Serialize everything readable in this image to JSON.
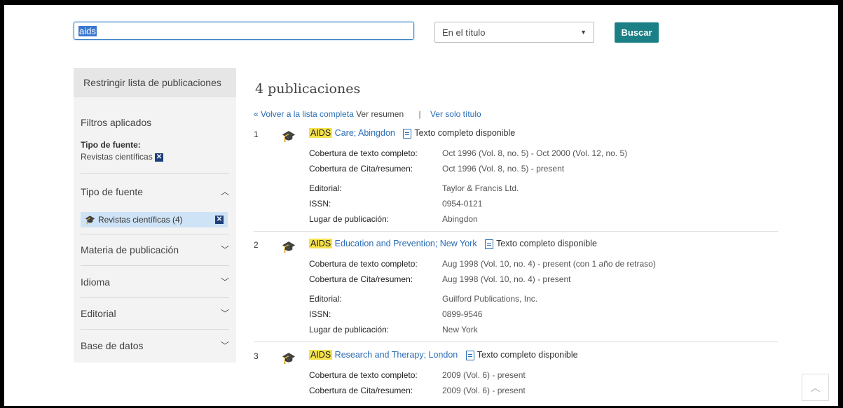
{
  "search": {
    "query": "aids",
    "field": "En el título",
    "button": "Buscar"
  },
  "sidebar": {
    "header": "Restringir lista de publicaciones",
    "applied_title": "Filtros aplicados",
    "applied_type_label": "Tipo de fuente:",
    "applied_type_value": "Revistas científicas",
    "facets": {
      "source_type": "Tipo de fuente",
      "source_type_selected": "Revistas científicas (4)",
      "subject": "Materia de publicación",
      "language": "Idioma",
      "publisher": "Editorial",
      "database": "Base de datos"
    }
  },
  "results": {
    "count": "4 publicaciones",
    "back_link": "« Volver a la lista completa",
    "view_summary": "Ver resumen",
    "separator": "|",
    "view_title": "Ver solo título",
    "items": [
      {
        "num": "1",
        "highlight": "AIDS",
        "title": "Care; Abingdon",
        "fulltext": "Texto completo disponible",
        "rows": [
          {
            "k": "Cobertura de texto completo:",
            "v": "Oct 1996 (Vol. 8, no. 5) - Oct 2000 (Vol. 12, no. 5)"
          },
          {
            "k": "Cobertura de Cita/resumen:",
            "v": "Oct 1996 (Vol. 8, no. 5) - present"
          },
          {
            "k": "Editorial:",
            "v": "Taylor & Francis Ltd."
          },
          {
            "k": "ISSN:",
            "v": "0954-0121"
          },
          {
            "k": "Lugar de publicación:",
            "v": "Abingdon"
          }
        ]
      },
      {
        "num": "2",
        "highlight": "AIDS",
        "title": "Education and Prevention; New York",
        "fulltext": "Texto completo disponible",
        "rows": [
          {
            "k": "Cobertura de texto completo:",
            "v": "Aug 1998 (Vol. 10, no. 4) - present (con 1 año de retraso)"
          },
          {
            "k": "Cobertura de Cita/resumen:",
            "v": "Aug 1998 (Vol. 10, no. 4) - present"
          },
          {
            "k": "Editorial:",
            "v": "Guilford Publications, Inc."
          },
          {
            "k": "ISSN:",
            "v": "0899-9546"
          },
          {
            "k": "Lugar de publicación:",
            "v": "New York"
          }
        ]
      },
      {
        "num": "3",
        "highlight": "AIDS",
        "title": "Research and Therapy; London",
        "fulltext": "Texto completo disponible",
        "rows": [
          {
            "k": "Cobertura de texto completo:",
            "v": "2009 (Vol. 6) - present"
          },
          {
            "k": "Cobertura de Cita/resumen:",
            "v": "2009 (Vol. 6) - present"
          }
        ]
      }
    ]
  }
}
